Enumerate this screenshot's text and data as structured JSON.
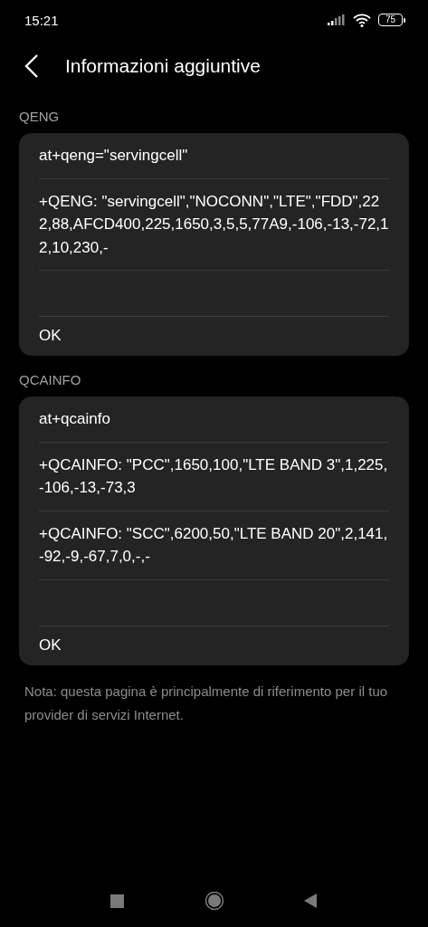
{
  "status_bar": {
    "time": "15:21",
    "battery": "75"
  },
  "header": {
    "title": "Informazioni aggiuntive"
  },
  "sections": [
    {
      "label": "QENG",
      "rows": [
        {
          "kind": "text",
          "text": "at+qeng=\"servingcell\""
        },
        {
          "kind": "text",
          "text": "+QENG: \"servingcell\",\"NOCONN\",\"LTE\",\"FDD\",222,88,AFCD400,225,1650,3,5,5,77A9,-106,-13,-72,12,10,230,-"
        },
        {
          "kind": "blank"
        },
        {
          "kind": "button",
          "text": "OK"
        }
      ]
    },
    {
      "label": "QCAINFO",
      "rows": [
        {
          "kind": "text",
          "text": "at+qcainfo"
        },
        {
          "kind": "text",
          "text": "+QCAINFO: \"PCC\",1650,100,\"LTE BAND 3\",1,225,-106,-13,-73,3"
        },
        {
          "kind": "text",
          "text": "+QCAINFO: \"SCC\",6200,50,\"LTE BAND 20\",2,141,-92,-9,-67,7,0,-,-"
        },
        {
          "kind": "blank"
        },
        {
          "kind": "button",
          "text": "OK"
        }
      ]
    }
  ],
  "note": "Nota: questa pagina è principalmente di riferimento per il tuo provider di servizi Internet."
}
